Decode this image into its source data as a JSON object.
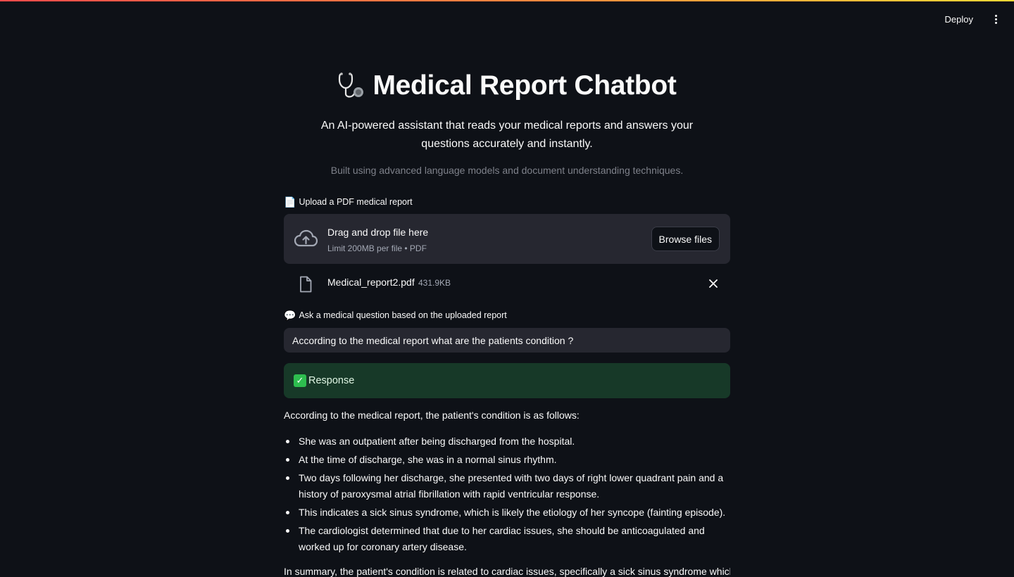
{
  "header": {
    "deploy_label": "Deploy"
  },
  "page": {
    "title": "Medical Report Chatbot",
    "subtitle": "An AI-powered assistant that reads your medical reports and answers your questions accurately and instantly.",
    "caption": "Built using advanced language models and document understanding techniques."
  },
  "uploader": {
    "label": "Upload a PDF medical report",
    "label_icon": "📄",
    "drop_title": "Drag and drop file here",
    "drop_limit": "Limit 200MB per file • PDF",
    "browse_label": "Browse files",
    "file": {
      "name": "Medical_report2.pdf",
      "size": "431.9KB"
    }
  },
  "question": {
    "label": "Ask a medical question based on the uploaded report",
    "label_icon": "💬",
    "value": "According to the medical report what are the patients condition ?"
  },
  "response": {
    "label": "Response",
    "intro": "According to the medical report, the patient's condition is as follows:",
    "items": [
      "She was an outpatient after being discharged from the hospital.",
      "At the time of discharge, she was in a normal sinus rhythm.",
      "Two days following her discharge, she presented with two days of right lower quadrant pain and a history of paroxysmal atrial fibrillation with rapid ventricular response.",
      "This indicates a sick sinus syndrome, which is likely the etiology of her syncope (fainting episode).",
      "The cardiologist determined that due to her cardiac issues, she should be anticoagulated and worked up for coronary artery disease."
    ],
    "cutoff_text": "In summary, the patient's condition is related to cardiac issues, specifically a sick sinus syndrome which"
  },
  "colors": {
    "background": "#0e1117",
    "surface": "#262730",
    "success_bg": "#173928",
    "accent_gradient_start": "#ff4b4b",
    "accent_gradient_end": "#fdd835"
  }
}
